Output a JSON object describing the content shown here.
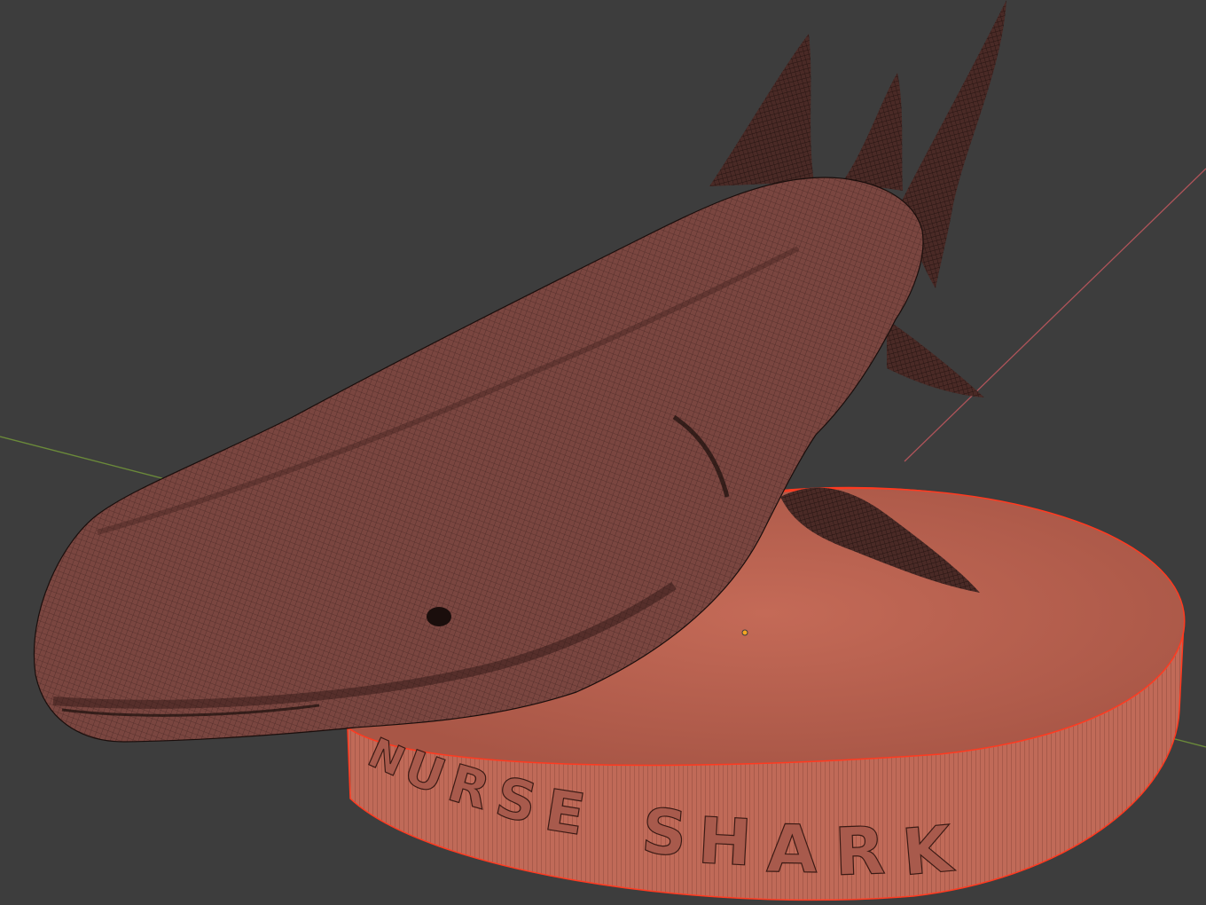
{
  "viewport": {
    "background": "#3d3d3d",
    "axis_x_color": "#b0545a",
    "axis_y_color": "#6b8a3a",
    "selection_outline_color": "#ff3a20",
    "origin_color": "#f5a623"
  },
  "scene": {
    "model": {
      "name": "shark-model",
      "mesh_color": "#7a4640",
      "wire_color": "#1a0e0c"
    },
    "base": {
      "name": "pedestal-base",
      "face_color": "#b0604f",
      "side_color": "#c26a58",
      "engraved_text": "NURSE SHARK"
    }
  }
}
